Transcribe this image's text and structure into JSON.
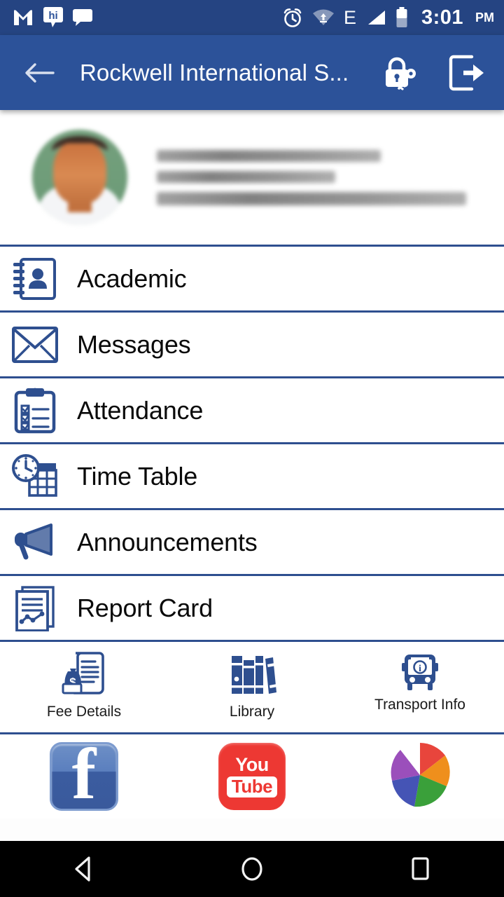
{
  "statusbar": {
    "time": "3:01",
    "ampm": "PM",
    "left_icons": [
      "gmail-icon",
      "hike-icon",
      "messaging-icon"
    ],
    "right_icons": [
      "alarm-icon",
      "wifi-icon",
      "edge-data-icon",
      "signal-icon",
      "battery-icon"
    ],
    "data_label": "E",
    "background": "#254482"
  },
  "appbar": {
    "title": "Rockwell International S...",
    "back_icon": "arrow-left-icon",
    "actions": [
      {
        "name": "change-password",
        "icon": "lock-key-icon"
      },
      {
        "name": "logout",
        "icon": "logout-icon"
      }
    ],
    "background": "#2C5299"
  },
  "profile": {
    "avatar_alt": "student-photo",
    "line1": "",
    "line2": "",
    "line3": "",
    "blurred": true
  },
  "menu": {
    "items": [
      {
        "label": "Academic",
        "icon": "contact-book-icon"
      },
      {
        "label": "Messages",
        "icon": "envelope-icon"
      },
      {
        "label": "Attendance",
        "icon": "clipboard-check-icon"
      },
      {
        "label": "Time Table",
        "icon": "clock-calendar-icon"
      },
      {
        "label": "Announcements",
        "icon": "megaphone-icon"
      },
      {
        "label": "Report Card",
        "icon": "report-chart-icon"
      }
    ],
    "icon_color": "#2e4f8f",
    "divider_color": "#2e4f8f"
  },
  "quick_links": [
    {
      "label": "Fee Details",
      "icon": "invoice-money-icon"
    },
    {
      "label": "Library",
      "icon": "books-icon"
    },
    {
      "label": "Transport Info",
      "icon": "bus-info-icon"
    }
  ],
  "social_links": [
    {
      "label": "Facebook",
      "icon": "facebook-icon",
      "color": "#3b5ca0"
    },
    {
      "label": "YouTube",
      "icon": "youtube-icon",
      "color": "#ed3833"
    },
    {
      "label": "Picasa",
      "icon": "picasa-icon",
      "color": "#e8aa00"
    }
  ],
  "navbar": {
    "back": "nav-back-icon",
    "home": "nav-home-icon",
    "recents": "nav-recents-icon"
  }
}
